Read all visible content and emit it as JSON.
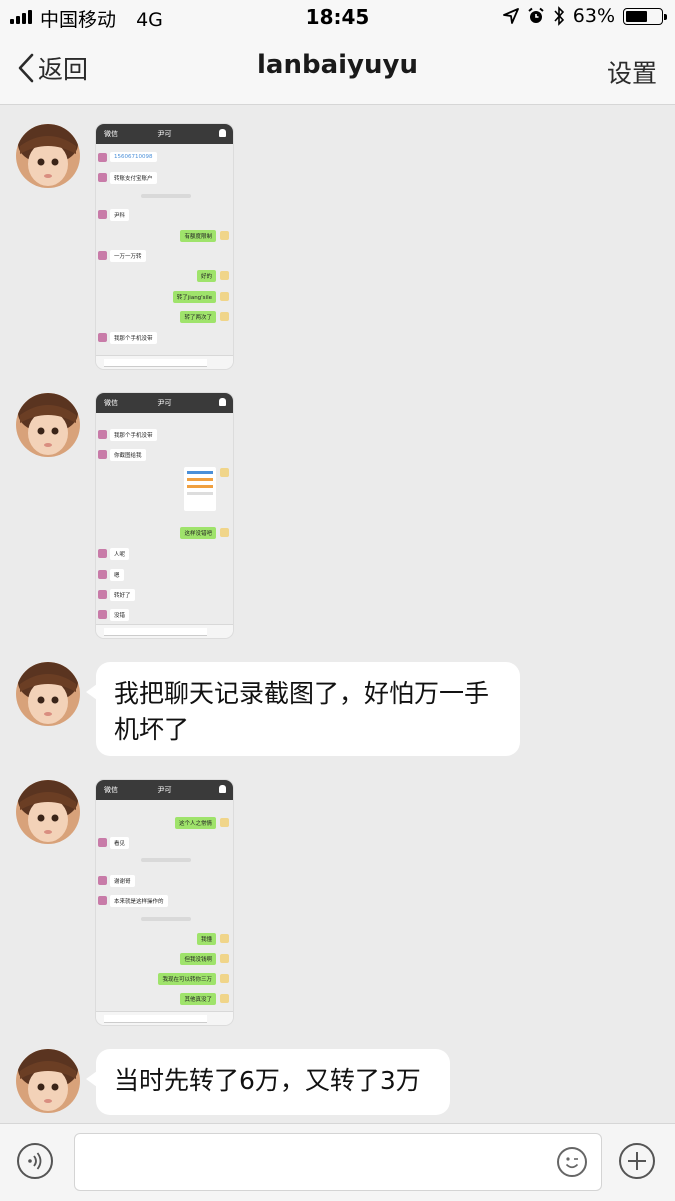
{
  "status_bar": {
    "carrier": "中国移动",
    "network": "4G",
    "time": "18:45",
    "battery_percent": "63%",
    "battery_level": 0.63,
    "icons": [
      "location-arrow-icon",
      "alarm-clock-icon",
      "bluetooth-icon",
      "battery-icon"
    ]
  },
  "navbar": {
    "back_label": "返回",
    "title": "lanbaiyuyu",
    "settings_label": "设置"
  },
  "messages": [
    {
      "type": "image",
      "screenshot": {
        "header_left": "微信",
        "header_title": "尹可",
        "rows": [
          {
            "dir": "in",
            "text": "15606710098",
            "link": true
          },
          {
            "dir": "in",
            "text": "转账支付宝账户"
          },
          {
            "dir": "in",
            "text": "尹科"
          },
          {
            "dir": "out",
            "text": "有额度限制"
          },
          {
            "dir": "in",
            "text": "一万一万转"
          },
          {
            "dir": "out",
            "text": "好的"
          },
          {
            "dir": "out",
            "text": "转了jiang'sile"
          },
          {
            "dir": "out",
            "text": "转了两次了"
          },
          {
            "dir": "in",
            "text": "我那个手机没带"
          }
        ]
      }
    },
    {
      "type": "image",
      "screenshot": {
        "header_left": "微信",
        "header_title": "尹可",
        "rows": [
          {
            "dir": "in",
            "text": "我那个手机没带"
          },
          {
            "dir": "in",
            "text": "你截图给我"
          },
          {
            "dir": "out",
            "text": "这样没错吧"
          },
          {
            "dir": "in",
            "text": "人呢"
          },
          {
            "dir": "in",
            "text": "嗯"
          },
          {
            "dir": "in",
            "text": "转好了"
          },
          {
            "dir": "in",
            "text": "没错"
          }
        ]
      }
    },
    {
      "type": "text",
      "text": "我把聊天记录截图了，好怕万一手机坏了"
    },
    {
      "type": "image",
      "screenshot": {
        "header_left": "微信",
        "header_title": "尹可",
        "rows": [
          {
            "dir": "out",
            "text": "这个人之常情"
          },
          {
            "dir": "in",
            "text": "看见"
          },
          {
            "dir": "in",
            "text": "谢谢哥"
          },
          {
            "dir": "in",
            "text": "本来就是这样操作的"
          },
          {
            "dir": "out",
            "text": "我懂"
          },
          {
            "dir": "out",
            "text": "但我没钱啊"
          },
          {
            "dir": "out",
            "text": "我现在可以转你三万"
          },
          {
            "dir": "out",
            "text": "其他真没了"
          }
        ]
      }
    },
    {
      "type": "text",
      "text": "当时先转了6万，又转了3万"
    }
  ],
  "input_bar": {
    "placeholder": "",
    "icons": [
      "voice-icon",
      "emoji-icon",
      "plus-icon"
    ]
  }
}
